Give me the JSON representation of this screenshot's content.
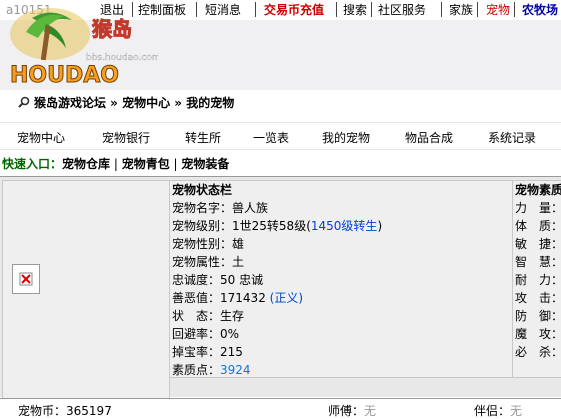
{
  "topbar": {
    "user": "a10151",
    "items": [
      "退出",
      "控制面板",
      "短消息",
      "交易币充值",
      "搜索",
      "社区服务",
      "家族",
      "宠物",
      "农牧场"
    ]
  },
  "logo": {
    "text": "HOUDAO",
    "brand_cn": "猴岛",
    "url": "bbs.houdao.com"
  },
  "breadcrumb": "猴岛游戏论坛 » 宠物中心 » 我的宠物",
  "nav": [
    "宠物中心",
    "宠物银行",
    "转生所",
    "一览表",
    "我的宠物",
    "物品合成",
    "系统记录"
  ],
  "quick": {
    "label": "快速入口：",
    "links": [
      "宠物仓库",
      "宠物青包",
      "宠物装备"
    ]
  },
  "status": {
    "title": "宠物状态栏",
    "name_label": "宠物名字：",
    "name": "兽人族",
    "level_label": "宠物级别：",
    "level": "1世25转58级",
    "level_link": "1450级转生",
    "gender_label": "宠物性别：",
    "gender": "雄",
    "attr_label": "宠物属性：",
    "attr": "土",
    "loyalty_label": "忠诚度：",
    "loyalty": "50 忠诚",
    "karma_label": "善恶值：",
    "karma": "171432",
    "karma_tag": "(正义)",
    "state_label": "状　态：",
    "state": "生存",
    "recover_label": "回避率：",
    "recover": "0%",
    "drop_label": "掉宝率：",
    "drop": "215",
    "points_label": "素质点：",
    "points": "3924"
  },
  "right": {
    "title": "宠物素质",
    "labels": [
      "力　量：",
      "体　质：",
      "敏　捷：",
      "智　慧：",
      "耐　力：",
      "攻　击：",
      "防　御：",
      "魔　攻：",
      "必　杀："
    ]
  },
  "bottom": {
    "coin_label": "宠物币：",
    "coin": "365197",
    "master_label": "师傅：",
    "master": "无",
    "partner_label": "伴侣：",
    "partner": "无"
  },
  "colors": {
    "red": "#cc0000",
    "blue": "#0000aa",
    "green": "#006600",
    "link": "#0044cc"
  }
}
